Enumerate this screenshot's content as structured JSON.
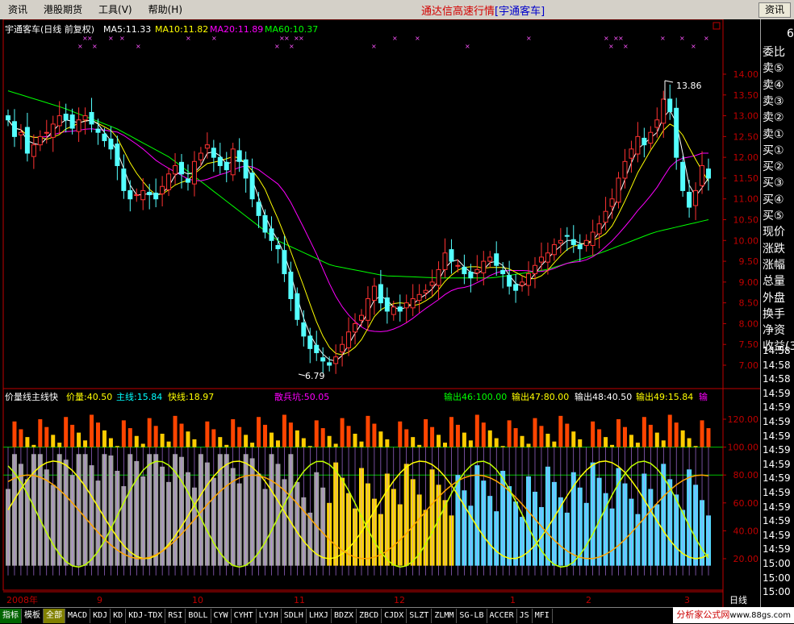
{
  "menu": {
    "items": [
      "资讯",
      "港股期货",
      "工具(V)",
      "帮助(H)"
    ],
    "right_button": "资讯"
  },
  "app_title": "通达信高速行情",
  "stock_title": "[宇通客车]",
  "upper": {
    "header": "宇通客车(日线 前复权)",
    "ma5": "MA5:11.33",
    "ma10": "MA10:11.82",
    "ma20": "MA20:11.89",
    "ma60": "MA60:10.37",
    "high_label": "13.86",
    "low_label": "6.79",
    "y_ticks": [
      "14.00",
      "13.50",
      "13.00",
      "12.50",
      "12.00",
      "11.50",
      "11.00",
      "10.50",
      "10.00",
      "9.50",
      "9.00",
      "8.50",
      "8.00",
      "7.50",
      "7.00"
    ],
    "ma5_color": "#ffffff",
    "ma10_color": "#ffff00",
    "ma20_color": "#ff00ff",
    "ma60_color": "#00ff00"
  },
  "lower": {
    "header": "价量线主线快",
    "jl": "价量:40.50",
    "zx": "主线:15.84",
    "kx": "快线:18.97",
    "sbk": "散兵坑:50.05",
    "o46": "输出46:100.00",
    "o47": "输出47:80.00",
    "o48": "输出48:40.50",
    "o49": "输出49:15.84",
    "o50": "输",
    "y_ticks": [
      "120.00",
      "100.00",
      "80.00",
      "60.00",
      "40.00",
      "20.00"
    ]
  },
  "x_labels": {
    "year": "2008年",
    "m9": "9",
    "m10": "10",
    "m11": "11",
    "m12": "12",
    "m1": "1",
    "m2": "2",
    "m3": "3"
  },
  "period": "日线",
  "side": {
    "top_val": "6",
    "labels": [
      "委比",
      "卖⑤",
      "卖④",
      "卖③",
      "卖②",
      "卖①",
      "买①",
      "买②",
      "买③",
      "买④",
      "买⑤",
      "现价",
      "涨跌",
      "涨幅",
      "总量",
      "外盘",
      "换手",
      "净资",
      "收益(3"
    ],
    "times": [
      "14:58",
      "14:58",
      "14:58",
      "14:59",
      "14:59",
      "14:59",
      "14:59",
      "14:59",
      "14:59",
      "14:59",
      "14:59",
      "14:59",
      "14:59",
      "14:59",
      "14:59",
      "15:00",
      "15:00",
      "15:00"
    ]
  },
  "tabs": [
    "指标",
    "模板",
    "全部",
    "MACD",
    "KDJ",
    "KD",
    "KDJ-TDX",
    "RSI",
    "BOLL",
    "CYW",
    "CYHT",
    "LYJH",
    "SDLH",
    "LHXJ",
    "BDZX",
    "ZBCD",
    "CJDX",
    "SLZT",
    "ZLMM",
    "SG-LB",
    "ACCER",
    "JS",
    "MFI"
  ],
  "watermark": {
    "text": "分析家公式网",
    "url": "www.88gs.com"
  },
  "chart_data": {
    "type": "candlestick",
    "closes": [
      12.9,
      12.5,
      12.6,
      12.1,
      12.3,
      12.5,
      12.6,
      12.8,
      13.0,
      12.9,
      12.7,
      12.9,
      13.0,
      12.8,
      12.6,
      12.4,
      12.2,
      11.8,
      11.2,
      11.0,
      11.1,
      11.2,
      11.1,
      11.0,
      11.3,
      11.6,
      11.8,
      11.6,
      11.4,
      11.9,
      12.1,
      12.3,
      12.0,
      11.8,
      11.7,
      12.2,
      11.9,
      11.5,
      11.0,
      10.6,
      10.2,
      10.0,
      9.8,
      9.2,
      8.6,
      8.1,
      7.7,
      7.4,
      7.3,
      7.1,
      7.0,
      7.2,
      7.5,
      7.8,
      8.0,
      8.2,
      8.6,
      8.9,
      8.5,
      8.3,
      8.4,
      8.3,
      8.5,
      8.6,
      8.7,
      8.8,
      9.0,
      9.3,
      9.7,
      9.5,
      9.4,
      9.2,
      9.1,
      9.3,
      9.5,
      9.6,
      9.4,
      9.2,
      8.9,
      8.8,
      9.0,
      9.2,
      9.4,
      9.6,
      9.7,
      9.9,
      10.0,
      10.1,
      9.9,
      9.8,
      10.0,
      10.2,
      10.4,
      10.7,
      11.0,
      11.5,
      11.9,
      12.2,
      12.5,
      12.3,
      12.6,
      12.9,
      13.4,
      13.1,
      12.0,
      11.2,
      10.8,
      11.2,
      11.8,
      11.5
    ]
  }
}
